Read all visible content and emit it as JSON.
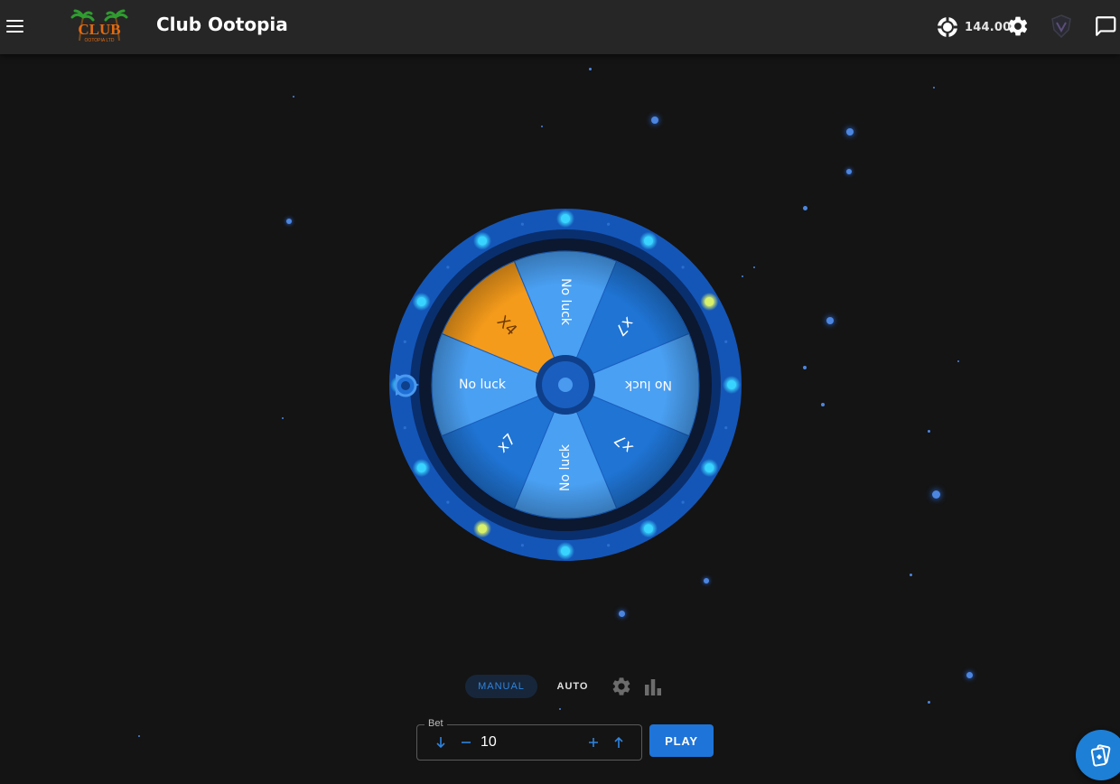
{
  "app": {
    "title": "Club Ootopia"
  },
  "logo": {
    "text": "CLUB",
    "subtext": "OOTOPIA LTD"
  },
  "header": {
    "balance": "144.00"
  },
  "wheel": {
    "segments": [
      {
        "label": "No luck",
        "color": "#4aa0f3",
        "text_color": "#ffffff"
      },
      {
        "label": "x7",
        "color": "#1f74d4",
        "text_color": "#ffffff"
      },
      {
        "label": "No luck",
        "color": "#4aa0f3",
        "text_color": "#ffffff"
      },
      {
        "label": "x7",
        "color": "#1f74d4",
        "text_color": "#ffffff"
      },
      {
        "label": "No luck",
        "color": "#4aa0f3",
        "text_color": "#ffffff"
      },
      {
        "label": "x7",
        "color": "#1f74d4",
        "text_color": "#ffffff"
      },
      {
        "label": "No luck",
        "color": "#4aa0f3",
        "text_color": "#ffffff"
      },
      {
        "label": "X4",
        "color": "#f59b1b",
        "text_color": "#6b3a00"
      }
    ],
    "colors": {
      "outer_ring": "#1456b8",
      "inner_ring": "#0a2f6e",
      "light_cyan": "#39d3ff",
      "light_yellow": "#d8f06a",
      "hub": "#1a5fbf"
    }
  },
  "controls": {
    "manual_label": "MANUAL",
    "auto_label": "AUTO",
    "bet_label": "Bet",
    "bet_value": "10",
    "play_label": "PLAY"
  },
  "icons": {
    "menu": "menu-icon",
    "balance": "chip-icon",
    "settings": "gear-icon",
    "avatar": "profile-shield-icon",
    "chat": "chat-icon",
    "game_settings": "gear-icon",
    "stats": "bar-chart-icon",
    "fab": "cards-icon"
  },
  "theme": {
    "accent": "#1e74d8",
    "background": "#141414",
    "header": "#262626"
  }
}
